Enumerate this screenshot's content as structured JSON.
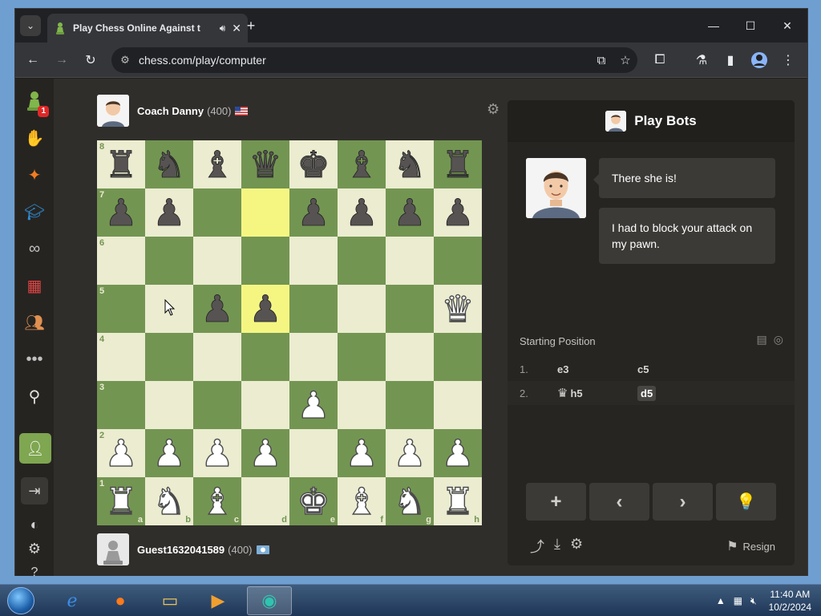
{
  "browser": {
    "tab_title": "Play Chess Online Against t",
    "tab_close": "✕",
    "new_tab": "+",
    "url": "chess.com/play/computer",
    "window_controls": {
      "minimize": "—",
      "maximize": "☐",
      "close": "✕"
    }
  },
  "top_player": {
    "name": "Coach Danny",
    "rating": "(400)"
  },
  "bottom_player": {
    "name": "Guest1632041589",
    "rating": "(400)"
  },
  "board": {
    "ranks": [
      "8",
      "7",
      "6",
      "5",
      "4",
      "3",
      "2",
      "1"
    ],
    "files": [
      "a",
      "b",
      "c",
      "d",
      "e",
      "f",
      "g",
      "h"
    ],
    "rows": [
      [
        "br",
        "bn",
        "bb",
        "bq",
        "bk",
        "bb",
        "bn",
        "br"
      ],
      [
        "bp",
        "bp",
        "",
        "",
        "bp",
        "bp",
        "bp",
        "bp"
      ],
      [
        "",
        "",
        "",
        "",
        "",
        "",
        "",
        ""
      ],
      [
        "",
        "",
        "bp",
        "bp",
        "",
        "",
        "",
        "wq"
      ],
      [
        "",
        "",
        "",
        "",
        "",
        "",
        "",
        ""
      ],
      [
        "",
        "",
        "",
        "",
        "wp",
        "",
        "",
        ""
      ],
      [
        "wp",
        "wp",
        "wp",
        "wp",
        "",
        "wp",
        "wp",
        "wp"
      ],
      [
        "wr",
        "wn",
        "wb",
        "",
        "wk",
        "wb",
        "wn",
        "wr"
      ]
    ],
    "highlight": [
      "d7",
      "d5"
    ],
    "piece_glyphs": {
      "wk": "♚",
      "wq": "♛",
      "wr": "♜",
      "wb": "♝",
      "wn": "♞",
      "wp": "♟",
      "bk": "♚",
      "bq": "♛",
      "br": "♜",
      "bb": "♝",
      "bn": "♞",
      "bp": "♟"
    },
    "colors": {
      "light": "#ebecd0",
      "dark": "#739552"
    }
  },
  "panel": {
    "title": "Play Bots",
    "messages": [
      "There she is!",
      "I had to block your attack on my pawn."
    ],
    "starting_position": "Starting Position",
    "moves": [
      {
        "num": "1.",
        "white": "e3",
        "white_fig": "",
        "black": "c5"
      },
      {
        "num": "2.",
        "white": "h5",
        "white_fig": "♛",
        "black": "d5"
      }
    ],
    "controls": [
      "+",
      "‹",
      "›",
      "💡"
    ],
    "resign": "Resign"
  },
  "taskbar": {
    "time": "11:40 AM",
    "date": "10/2/2024"
  }
}
